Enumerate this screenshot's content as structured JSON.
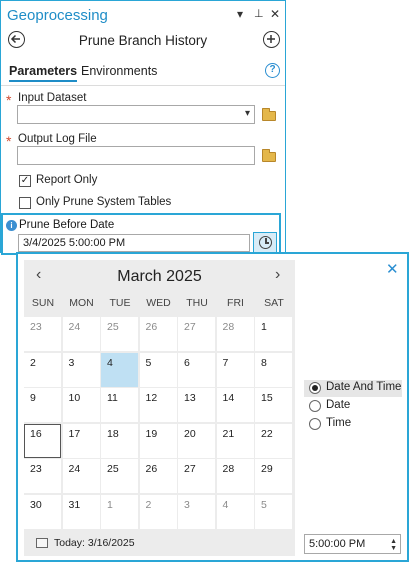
{
  "pane": {
    "title": "Geoprocessing",
    "tool_name": "Prune Branch History",
    "tabs": [
      "Parameters",
      "Environments"
    ],
    "help_glyph": "?"
  },
  "params": {
    "input_dataset_label": "Input Dataset",
    "input_dataset_value": "",
    "output_log_label": "Output Log File",
    "output_log_value": "",
    "report_only_label": "Report Only",
    "report_only_checked": true,
    "prune_system_label": "Only Prune System Tables",
    "prune_system_checked": false,
    "prune_before_label": "Prune Before Date",
    "prune_before_value": "3/4/2025 5:00:00 PM"
  },
  "calendar": {
    "month_label": "March 2025",
    "days_of_week": [
      "SUN",
      "MON",
      "TUE",
      "WED",
      "THU",
      "FRI",
      "SAT"
    ],
    "weeks": [
      [
        "23",
        "24",
        "25",
        "26",
        "27",
        "28",
        "1"
      ],
      [
        "2",
        "3",
        "4",
        "5",
        "6",
        "7",
        "8"
      ],
      [
        "9",
        "10",
        "11",
        "12",
        "13",
        "14",
        "15"
      ],
      [
        "16",
        "17",
        "18",
        "19",
        "20",
        "21",
        "22"
      ],
      [
        "23",
        "24",
        "25",
        "26",
        "27",
        "28",
        "29"
      ],
      [
        "30",
        "31",
        "1",
        "2",
        "3",
        "4",
        "5"
      ]
    ],
    "selected_day": "4",
    "today_day": "16",
    "today_label": "Today: 3/16/2025"
  },
  "options": [
    "Date And Time",
    "Date",
    "Time"
  ],
  "selected_option": "Date And Time",
  "time_value": "5:00:00 PM",
  "colors": {
    "accent": "#2aa6d6",
    "title_blue": "#1f8dc7",
    "required_red": "#d04a2f",
    "selected_day_bg": "#bfe0f3",
    "calendar_bg": "#ececec"
  },
  "icons": {
    "menu": "chevron-down-icon",
    "pin": "pin-icon",
    "close_pane": "close-icon",
    "back": "back-icon",
    "add": "add-icon",
    "help": "help-icon",
    "folder": "folder-icon",
    "clock": "clock-icon",
    "info": "info-icon",
    "prev_month": "chevron-left-icon",
    "next_month": "chevron-right-icon",
    "close_popup": "close-icon",
    "spinner": "spinner-icon"
  }
}
